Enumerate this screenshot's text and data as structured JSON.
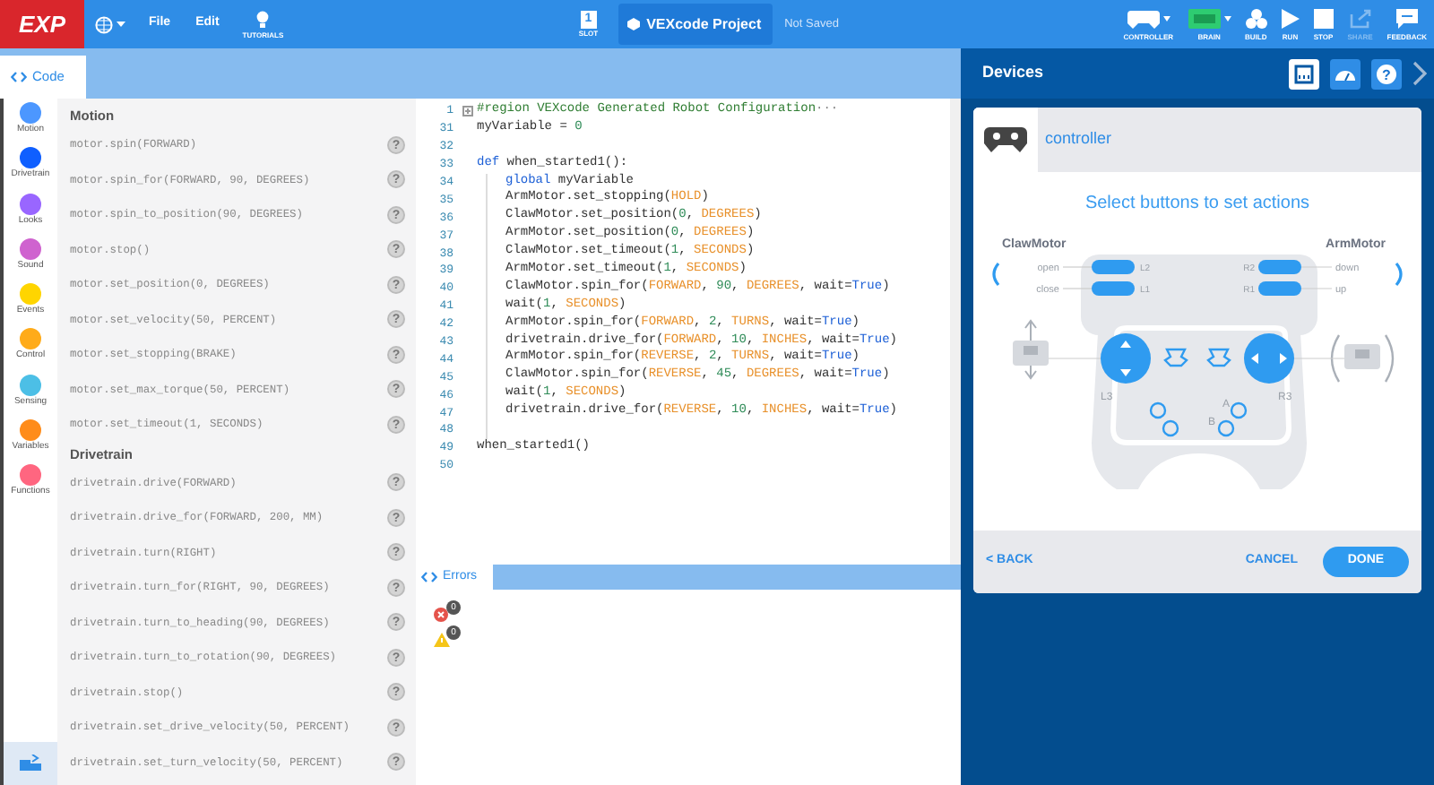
{
  "top_bar": {
    "logo": "EXP",
    "menus": [
      "File",
      "Edit"
    ],
    "tutorials": "TUTORIALS",
    "slot": {
      "number": "1",
      "label": "SLOT"
    },
    "project_name": "VEXcode Project",
    "save_status": "Not Saved",
    "tools": [
      {
        "kind": "controller",
        "label": "CONTROLLER",
        "disabled": false
      },
      {
        "kind": "brain",
        "label": "BRAIN",
        "disabled": false
      },
      {
        "kind": "build",
        "label": "BUILD",
        "disabled": false
      },
      {
        "kind": "run",
        "label": "RUN",
        "disabled": false
      },
      {
        "kind": "stop",
        "label": "STOP",
        "disabled": false
      },
      {
        "kind": "share",
        "label": "SHARE",
        "disabled": true
      },
      {
        "kind": "feedback",
        "label": "FEEDBACK",
        "disabled": false
      }
    ]
  },
  "code_tab": "Code",
  "categories": [
    {
      "label": "Motion",
      "color": "#4c97ff"
    },
    {
      "label": "Drivetrain",
      "color": "#0f5fff"
    },
    {
      "label": "Looks",
      "color": "#9966ff"
    },
    {
      "label": "Sound",
      "color": "#cf63cf"
    },
    {
      "label": "Events",
      "color": "#ffd500"
    },
    {
      "label": "Control",
      "color": "#ffab19"
    },
    {
      "label": "Sensing",
      "color": "#4cbfe6"
    },
    {
      "label": "Variables",
      "color": "#ff8c1a"
    },
    {
      "label": "Functions",
      "color": "#ff6680"
    }
  ],
  "palette": [
    {
      "heading": "Motion",
      "items": [
        {
          "code": "motor.spin(FORWARD)",
          "help": "?"
        },
        {
          "code": "motor.spin_for(FORWARD, 90, DEGREES)",
          "help": "?"
        },
        {
          "code": "motor.spin_to_position(90, DEGREES)",
          "help": "?"
        },
        {
          "code": "motor.stop()",
          "help": "?"
        },
        {
          "code": "motor.set_position(0, DEGREES)",
          "help": "?"
        },
        {
          "code": "motor.set_velocity(50, PERCENT)",
          "help": "?"
        },
        {
          "code": "motor.set_stopping(BRAKE)",
          "help": "?"
        },
        {
          "code": "motor.set_max_torque(50, PERCENT)",
          "help": "?"
        },
        {
          "code": "motor.set_timeout(1, SECONDS)",
          "help": "?"
        }
      ]
    },
    {
      "heading": "Drivetrain",
      "items": [
        {
          "code": "drivetrain.drive(FORWARD)",
          "help": "?"
        },
        {
          "code": "drivetrain.drive_for(FORWARD, 200, MM)",
          "help": "?"
        },
        {
          "code": "drivetrain.turn(RIGHT)",
          "help": "?"
        },
        {
          "code": "drivetrain.turn_for(RIGHT, 90, DEGREES)",
          "help": "?"
        },
        {
          "code": "drivetrain.turn_to_heading(90, DEGREES)",
          "help": "?"
        },
        {
          "code": "drivetrain.turn_to_rotation(90, DEGREES)",
          "help": "?"
        },
        {
          "code": "drivetrain.stop()",
          "help": "?"
        },
        {
          "code": "drivetrain.set_drive_velocity(50, PERCENT)",
          "help": "?"
        },
        {
          "code": "drivetrain.set_turn_velocity(50, PERCENT)",
          "help": "?"
        }
      ]
    }
  ],
  "editor": {
    "lines": [
      {
        "number": "1",
        "collapsed": true,
        "tokens": [
          {
            "text": "#region VEXcode Generated Robot Configuration",
            "kind": "comment"
          },
          {
            "text": "···",
            "kind": "fold"
          }
        ]
      },
      {
        "number": "31",
        "tokens": [
          {
            "text": "myVariable = ",
            "kind": "plain"
          },
          {
            "text": "0",
            "kind": "number"
          }
        ]
      },
      {
        "number": "32"
      },
      {
        "number": "33",
        "tokens": [
          {
            "text": "def",
            "kind": "keyword"
          },
          {
            "text": " when_started1():",
            "kind": "plain"
          }
        ],
        "children": [
          {
            "number": "34",
            "tokens": [
              {
                "text": "global",
                "kind": "keyword"
              },
              {
                "text": " myVariable",
                "kind": "plain"
              }
            ]
          },
          {
            "number": "35",
            "tokens": [
              {
                "text": "ArmMotor.set_stopping(",
                "kind": "plain"
              },
              {
                "text": "HOLD",
                "kind": "constant"
              },
              {
                "text": ")",
                "kind": "plain"
              }
            ]
          },
          {
            "number": "36",
            "tokens": [
              {
                "text": "ClawMotor.set_position(",
                "kind": "plain"
              },
              {
                "text": "0",
                "kind": "number"
              },
              {
                "text": ", ",
                "kind": "plain"
              },
              {
                "text": "DEGREES",
                "kind": "constant"
              },
              {
                "text": ")",
                "kind": "plain"
              }
            ]
          },
          {
            "number": "37",
            "tokens": [
              {
                "text": "ArmMotor.set_position(",
                "kind": "plain"
              },
              {
                "text": "0",
                "kind": "number"
              },
              {
                "text": ", ",
                "kind": "plain"
              },
              {
                "text": "DEGREES",
                "kind": "constant"
              },
              {
                "text": ")",
                "kind": "plain"
              }
            ]
          },
          {
            "number": "38",
            "tokens": [
              {
                "text": "ClawMotor.set_timeout(",
                "kind": "plain"
              },
              {
                "text": "1",
                "kind": "number"
              },
              {
                "text": ", ",
                "kind": "plain"
              },
              {
                "text": "SECONDS",
                "kind": "constant"
              },
              {
                "text": ")",
                "kind": "plain"
              }
            ]
          },
          {
            "number": "39",
            "tokens": [
              {
                "text": "ArmMotor.set_timeout(",
                "kind": "plain"
              },
              {
                "text": "1",
                "kind": "number"
              },
              {
                "text": ", ",
                "kind": "plain"
              },
              {
                "text": "SECONDS",
                "kind": "constant"
              },
              {
                "text": ")",
                "kind": "plain"
              }
            ]
          },
          {
            "number": "40",
            "tokens": [
              {
                "text": "ClawMotor.spin_for(",
                "kind": "plain"
              },
              {
                "text": "FORWARD",
                "kind": "constant"
              },
              {
                "text": ", ",
                "kind": "plain"
              },
              {
                "text": "90",
                "kind": "number"
              },
              {
                "text": ", ",
                "kind": "plain"
              },
              {
                "text": "DEGREES",
                "kind": "constant"
              },
              {
                "text": ", wait=",
                "kind": "plain"
              },
              {
                "text": "True",
                "kind": "keyword"
              },
              {
                "text": ")",
                "kind": "plain"
              }
            ]
          },
          {
            "number": "41",
            "tokens": [
              {
                "text": "wait(",
                "kind": "plain"
              },
              {
                "text": "1",
                "kind": "number"
              },
              {
                "text": ", ",
                "kind": "plain"
              },
              {
                "text": "SECONDS",
                "kind": "constant"
              },
              {
                "text": ")",
                "kind": "plain"
              }
            ]
          },
          {
            "number": "42",
            "tokens": [
              {
                "text": "ArmMotor.spin_for(",
                "kind": "plain"
              },
              {
                "text": "FORWARD",
                "kind": "constant"
              },
              {
                "text": ", ",
                "kind": "plain"
              },
              {
                "text": "2",
                "kind": "number"
              },
              {
                "text": ", ",
                "kind": "plain"
              },
              {
                "text": "TURNS",
                "kind": "constant"
              },
              {
                "text": ", wait=",
                "kind": "plain"
              },
              {
                "text": "True",
                "kind": "keyword"
              },
              {
                "text": ")",
                "kind": "plain"
              }
            ]
          },
          {
            "number": "43",
            "tokens": [
              {
                "text": "drivetrain.drive_for(",
                "kind": "plain"
              },
              {
                "text": "FORWARD",
                "kind": "constant"
              },
              {
                "text": ", ",
                "kind": "plain"
              },
              {
                "text": "10",
                "kind": "number"
              },
              {
                "text": ", ",
                "kind": "plain"
              },
              {
                "text": "INCHES",
                "kind": "constant"
              },
              {
                "text": ", wait=",
                "kind": "plain"
              },
              {
                "text": "True",
                "kind": "keyword"
              },
              {
                "text": ")",
                "kind": "plain"
              }
            ]
          },
          {
            "number": "44",
            "tokens": [
              {
                "text": "ArmMotor.spin_for(",
                "kind": "plain"
              },
              {
                "text": "REVERSE",
                "kind": "constant"
              },
              {
                "text": ", ",
                "kind": "plain"
              },
              {
                "text": "2",
                "kind": "number"
              },
              {
                "text": ", ",
                "kind": "plain"
              },
              {
                "text": "TURNS",
                "kind": "constant"
              },
              {
                "text": ", wait=",
                "kind": "plain"
              },
              {
                "text": "True",
                "kind": "keyword"
              },
              {
                "text": ")",
                "kind": "plain"
              }
            ]
          },
          {
            "number": "45",
            "tokens": [
              {
                "text": "ClawMotor.spin_for(",
                "kind": "plain"
              },
              {
                "text": "REVERSE",
                "kind": "constant"
              },
              {
                "text": ", ",
                "kind": "plain"
              },
              {
                "text": "45",
                "kind": "number"
              },
              {
                "text": ", ",
                "kind": "plain"
              },
              {
                "text": "DEGREES",
                "kind": "constant"
              },
              {
                "text": ", wait=",
                "kind": "plain"
              },
              {
                "text": "True",
                "kind": "keyword"
              },
              {
                "text": ")",
                "kind": "plain"
              }
            ]
          },
          {
            "number": "46",
            "tokens": [
              {
                "text": "wait(",
                "kind": "plain"
              },
              {
                "text": "1",
                "kind": "number"
              },
              {
                "text": ", ",
                "kind": "plain"
              },
              {
                "text": "SECONDS",
                "kind": "constant"
              },
              {
                "text": ")",
                "kind": "plain"
              }
            ]
          },
          {
            "number": "47",
            "tokens": [
              {
                "text": "drivetrain.drive_for(",
                "kind": "plain"
              },
              {
                "text": "REVERSE",
                "kind": "constant"
              },
              {
                "text": ", ",
                "kind": "plain"
              },
              {
                "text": "10",
                "kind": "number"
              },
              {
                "text": ", ",
                "kind": "plain"
              },
              {
                "text": "INCHES",
                "kind": "constant"
              },
              {
                "text": ", wait=",
                "kind": "plain"
              },
              {
                "text": "True",
                "kind": "keyword"
              },
              {
                "text": ")",
                "kind": "plain"
              }
            ]
          },
          {
            "number": "48"
          }
        ]
      },
      {
        "number": "49",
        "tokens": [
          {
            "text": "when_started1()",
            "kind": "plain"
          }
        ]
      },
      {
        "number": "50"
      }
    ]
  },
  "errors_panel": {
    "tab": "Errors",
    "counts": [
      {
        "kind": "error",
        "count": "0"
      },
      {
        "kind": "warning",
        "count": "0"
      }
    ]
  },
  "devices_panel": {
    "title": "Devices",
    "tools": [
      {
        "kind": "ports",
        "selected": true
      },
      {
        "kind": "dashboard",
        "selected": false
      },
      {
        "kind": "help",
        "selected": false,
        "label": "?"
      }
    ],
    "device_name": "controller",
    "heading": "Select buttons to set actions",
    "left_group": {
      "motor": "ClawMotor",
      "actions": [
        {
          "label": "open",
          "button": "L2"
        },
        {
          "label": "close",
          "button": "L1"
        }
      ]
    },
    "right_group": {
      "motor": "ArmMotor",
      "actions": [
        {
          "label": "down",
          "button": "R2"
        },
        {
          "label": "up",
          "button": "R1"
        }
      ]
    },
    "stick_labels": [
      "L3",
      "R3"
    ],
    "button_labels": [
      "A",
      "B"
    ],
    "back": "< BACK",
    "cancel": "CANCEL",
    "done": "DONE"
  }
}
